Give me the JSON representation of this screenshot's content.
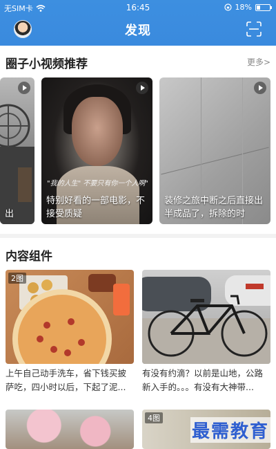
{
  "status_bar": {
    "carrier": "无SIM卡",
    "time": "16:45",
    "battery": "18%",
    "battery_fraction": 0.18
  },
  "nav": {
    "title": "发现",
    "left_icon": "avatar",
    "right_icon": "scan-icon"
  },
  "video_section": {
    "title": "圈子小视频推荐",
    "more": "更多>",
    "cards": [
      {
        "caption": "出"
      },
      {
        "subtitle": "\"我的人生\" 不要只有你一个人啊\"",
        "caption": "特别好看的一部电影，不接受质疑"
      },
      {
        "caption": "装修之旅中断之后直接出半成品了，拆除的时"
      }
    ]
  },
  "content_section": {
    "title": "内容组件",
    "items": [
      {
        "badge": "2图",
        "text": "上午自己动手洗车，省下钱买披萨吃，四小时以后，下起了泥..."
      },
      {
        "badge": "",
        "text": "有没有约滴？以前是山地，公路新入手的。。。有没有大神带..."
      },
      {
        "badge": "",
        "text": ""
      },
      {
        "badge": "4图",
        "text": ""
      }
    ]
  },
  "watermark": "最需教育"
}
